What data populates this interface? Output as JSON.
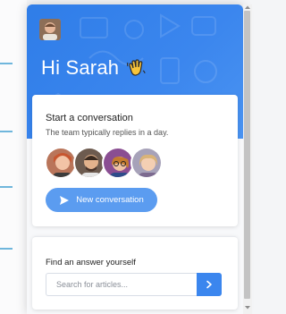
{
  "header": {
    "greeting": "Hi Sarah",
    "wave_emoji": "👋",
    "accent": "#3b86ee"
  },
  "conversation_card": {
    "title": "Start a conversation",
    "subtitle": "The team typically replies in a day.",
    "button_label": "New conversation",
    "team_avatars": [
      "team-member-1",
      "team-member-2",
      "team-member-3",
      "team-member-4"
    ]
  },
  "help_card": {
    "title": "Find an answer yourself",
    "search_placeholder": "Search for articles..."
  },
  "icons": {
    "send": "send-icon",
    "search_submit": "chevron-right-icon"
  }
}
